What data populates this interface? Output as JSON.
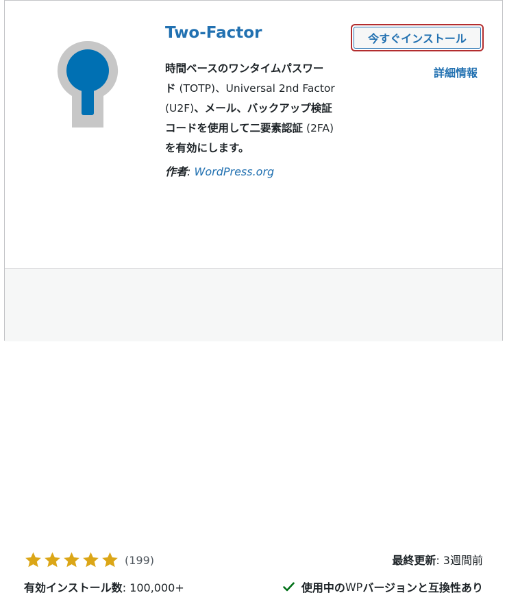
{
  "plugin": {
    "title": "Two-Factor",
    "install_button_label": "今すぐインストール",
    "details_link_label": "詳細情報",
    "description": {
      "line1": "時間ベースのワンタイムパスワー",
      "line2_bold": "ド",
      "line2_plain": " (TOTP)、Universal 2nd Factor",
      "line3_plain": "(U2F)",
      "line3_bold": "、メール、バックアップ検証",
      "line4_bold": "コードを使用して二要素認証",
      "line4_plain": " (2FA)",
      "line5": "を有効にします。"
    },
    "author_label": "作者",
    "author_sep": ": ",
    "author_name": "WordPress.org",
    "icon": "keyhole-icon"
  },
  "footer": {
    "rating_stars": 5,
    "rating_count": "(199)",
    "installs_label": "有効インストール数",
    "installs_value": ": 100,000+",
    "updated_label": "最終更新",
    "updated_value": ": 3週間前",
    "compat_pre": "使用中の",
    "compat_wp": " WP ",
    "compat_post": "バージョンと互換性あり"
  },
  "colors": {
    "accent": "#2271b1",
    "star": "#dba617",
    "focus_ring": "#b32d2e",
    "check": "#007017"
  }
}
